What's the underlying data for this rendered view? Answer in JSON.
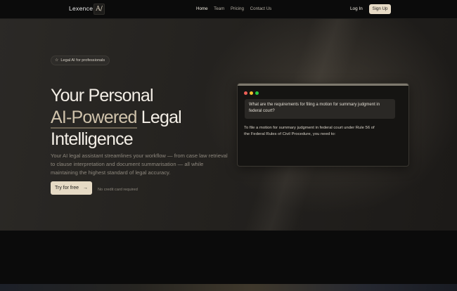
{
  "nav": {
    "brand": "Lexence",
    "brand_mark": "A/",
    "links": [
      {
        "label": "Home",
        "active": true
      },
      {
        "label": "Team",
        "active": false
      },
      {
        "label": "Pricing",
        "active": false
      },
      {
        "label": "Contact Us",
        "active": false
      }
    ],
    "login": "Log In",
    "signup": "Sign Up"
  },
  "hero": {
    "badge": "Legal AI for professionals",
    "badge_icon": "star-icon",
    "headline_line1": "Your Personal",
    "headline_accent": "AI-Powered",
    "headline_line2_rest": " Legal",
    "headline_line3": "Intelligence",
    "description": "Your AI legal assistant streamlines your workflow — from case law retrieval to clause interpretation and document summarisation — all while maintaining the highest standard of legal accuracy.",
    "cta_label": "Try for free",
    "cta_icon": "arrow-right-icon",
    "cta_note": "No credit card required"
  },
  "chat_window": {
    "question": "What are the requirements for filing a motion for summary judgment in federal court?",
    "answer": "To file a motion for summary judgment in federal court under Rule 56 of the Federal Rules of Civil Procedure, you need to:"
  },
  "colors": {
    "accent": "#e6dac5",
    "window_dot_red": "#ed5f57",
    "window_dot_yellow": "#f5bf2f",
    "window_dot_green": "#29c840"
  }
}
